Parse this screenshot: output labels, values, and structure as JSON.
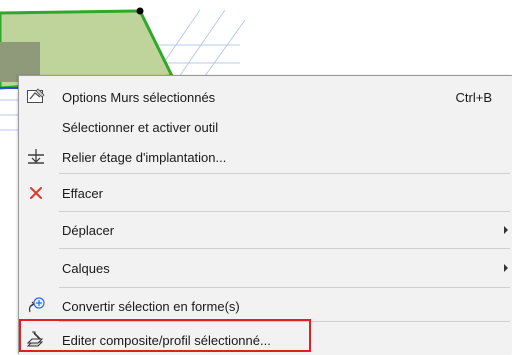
{
  "menu": {
    "items": [
      {
        "label": "Options Murs sélectionnés",
        "shortcut": "Ctrl+B",
        "icon": "wall-settings-icon"
      },
      {
        "label": "Sélectionner et activer outil",
        "shortcut": "",
        "icon": ""
      },
      {
        "label": "Relier étage d'implantation...",
        "shortcut": "",
        "icon": "link-story-icon"
      },
      {
        "label": "Effacer",
        "shortcut": "",
        "icon": "delete-x-icon"
      },
      {
        "label": "Déplacer",
        "shortcut": "",
        "icon": "",
        "submenu": true
      },
      {
        "label": "Calques",
        "shortcut": "",
        "icon": "",
        "submenu": true
      },
      {
        "label": "Convertir sélection en forme(s)",
        "shortcut": "",
        "icon": "convert-shape-icon"
      },
      {
        "label": "Editer composite/profil sélectionné...",
        "shortcut": "",
        "icon": "edit-composite-icon"
      }
    ]
  },
  "colors": {
    "menu_bg": "#f2f2f2",
    "wall_fill": "#b8cf8f",
    "wall_edge": "#2da82d",
    "delete_red": "#e03a2a",
    "highlight_red": "#e02020",
    "grid_blue": "#9fb6e8"
  }
}
